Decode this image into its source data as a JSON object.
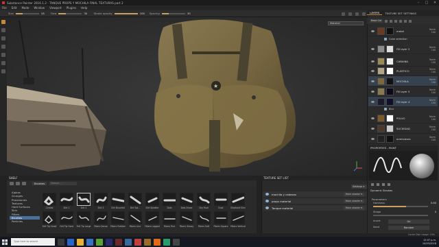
{
  "window": {
    "title": "Substance Painter 2016.1.2 - TANQUE PROPS Y MOCHILA FINAL TEXTURAS part 2",
    "controls": [
      "–",
      "□",
      "✕"
    ]
  },
  "menu": [
    "File",
    "Edit",
    "Mode",
    "Window",
    "Viewport",
    "Plugins",
    "Help"
  ],
  "tool_options": [
    {
      "label": "Size",
      "value": "18",
      "fill": 0.3
    },
    {
      "label": "Flow",
      "value": "30",
      "fill": 0.3
    },
    {
      "label": "Stroke opacity",
      "value": "100",
      "fill": 1.0
    },
    {
      "label": "Spacing",
      "value": "30",
      "fill": 0.3
    }
  ],
  "viewport": {
    "display_mode": "Material"
  },
  "colors": {
    "accent": "#c88a3a",
    "selection": "#4b6e9a",
    "panel": "#2b2b2b"
  },
  "shelf": {
    "title": "SHELF",
    "filter_label": "Brushes",
    "search_placeholder": "Search...",
    "categories": [
      "Alphas",
      "Grunges",
      "Procedurals",
      "Textures",
      "Hard Surfaces",
      "Skin",
      "Filters",
      "Brushes",
      "Particles"
    ],
    "selected_category": "Brushes",
    "brushes": [
      "Crystal",
      "Dirt 1",
      "Dirt 2",
      "Dirt 3",
      "Dirt Brushed",
      "Dirt Spl...",
      "Dirt Splatter",
      "Dots",
      "Dots Erase",
      "Dry Mud",
      "Dust",
      "Elephant Skin",
      "Felt Tip Small",
      "Felt Tip Hard",
      "Felt Tip Large",
      "Fibers Dense",
      "Fibers Feather",
      "Fibers Line",
      "Fibers Lagged",
      "Fibers Fine",
      "Fibers Glossy",
      "Fibers Soft",
      "Fibers Square",
      "Fibers Vertical"
    ],
    "selected_brush": "Dirt 2"
  },
  "texture_set_list": {
    "title": "TEXTURE SET LIST",
    "settings_label": "Settings ▾",
    "rows": [
      {
        "name": "mochila y cabezas",
        "shader": "Main shader ▾"
      },
      {
        "name": "props material",
        "shader": "Main shader ▾"
      },
      {
        "name": "Tanque material",
        "shader": "Main shader ▾"
      }
    ]
  },
  "layers_panel": {
    "tabs": [
      "LAYERS",
      "TEXTURE SET SETTINGS"
    ],
    "channel": "Base Col",
    "layers": [
      {
        "name": "metal",
        "blend": "Norm",
        "opacity": "100"
      },
      {
        "name": "Fill layer 2",
        "blend": "Norm",
        "opacity": "100"
      },
      {
        "name": "CABAINA",
        "blend": "Norm",
        "opacity": "100"
      },
      {
        "name": "PLASTICO",
        "blend": "Norm",
        "opacity": "100"
      },
      {
        "name": "MOCHILA",
        "blend": "Norm",
        "opacity": "100"
      },
      {
        "name": "Fill layer 5",
        "blend": "Norm",
        "opacity": "100"
      },
      {
        "name": "Fill layer 4",
        "blend": "Norm",
        "opacity": "100"
      },
      {
        "name": "POLVO",
        "blend": "Norm",
        "opacity": "100"
      },
      {
        "name": "SUCIEDAD",
        "blend": "Norm",
        "opacity": "100"
      },
      {
        "name": "oversrasos",
        "blend": "Norm",
        "opacity": "100"
      }
    ],
    "sublabels": {
      "color_selection": "Color selection",
      "blur": "Blur"
    }
  },
  "properties": {
    "title": "PROPERTIES - PAINT",
    "section": "Dynamic Strokes",
    "params_title": "Parameters",
    "hardness_label": "Hardness",
    "hardness_value": "0.60",
    "hardness": 0.6,
    "shape_label": "Shape",
    "shape_value": "0",
    "invert_label": "Invert",
    "invert_value": "On",
    "seed_label": "Seed",
    "seed_value": "Random"
  },
  "status": {
    "text": "Cache Disk Usage: 19%"
  },
  "taskbar": {
    "search": "Type here to search",
    "time": "12:07 p.m.",
    "date": "10/03/2018",
    "lang": "ESP"
  }
}
